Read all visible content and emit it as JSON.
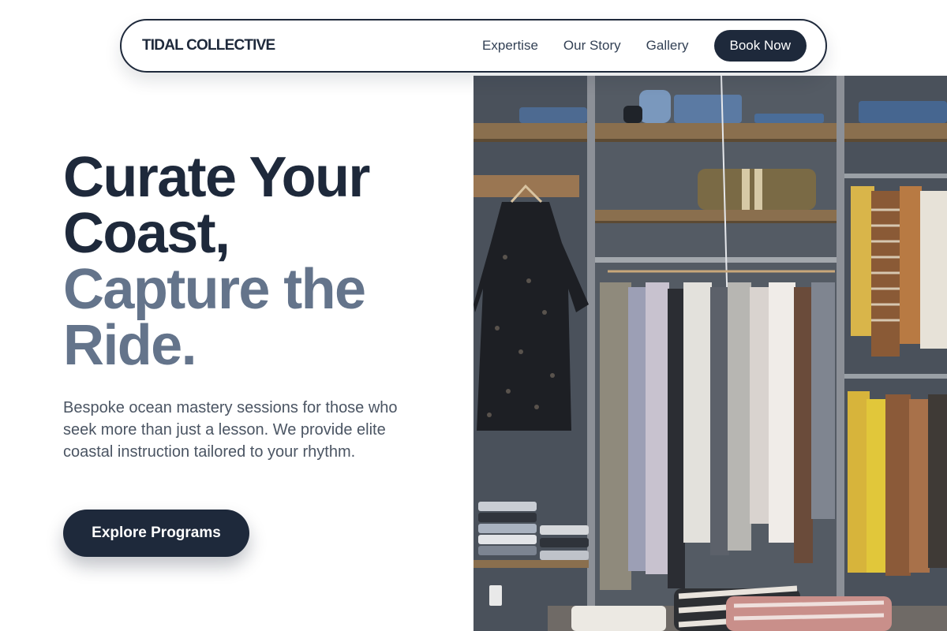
{
  "nav": {
    "brand": "TIDAL COLLECTIVE",
    "links": [
      "Expertise",
      "Our Story",
      "Gallery"
    ],
    "cta_label": "Book Now"
  },
  "hero": {
    "headline_dark_1": "Curate Your",
    "headline_dark_2": "Coast,",
    "headline_light_1": "Capture the",
    "headline_light_2": "Ride.",
    "lead": "Bespoke ocean mastery sessions for those who seek more than just a lesson. We provide elite coastal instruction tailored to your rhythm.",
    "cta_label": "Explore Programs"
  },
  "colors": {
    "primary": "#1e293b",
    "muted_heading": "#64748b",
    "body_text": "#4b5563",
    "background": "#ffffff"
  },
  "icons": {
    "hero_image": "clothing-rack-photo"
  }
}
